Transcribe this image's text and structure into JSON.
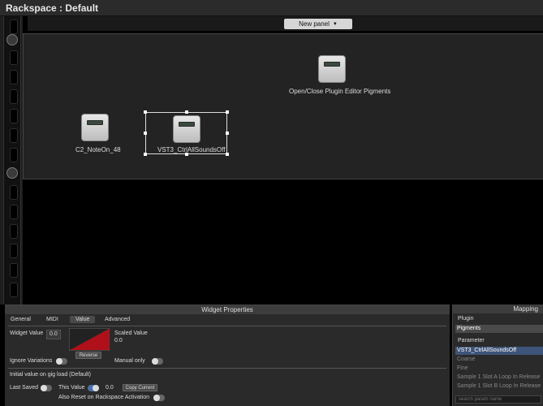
{
  "window": {
    "title": "Rackspace : Default"
  },
  "toolbar": {
    "new_panel_label": "New panel",
    "new_panel_arrow": "▼"
  },
  "panel": {
    "widgets": [
      {
        "label": "Open/Close Plugin Editor Pigments"
      },
      {
        "label": "C2_NoteOn_48"
      },
      {
        "label": "VST3_CtrlAllSoundsOff"
      }
    ]
  },
  "properties": {
    "header": "Widget Properties",
    "tabs": [
      "General",
      "MIDI",
      "Value",
      "Advanced"
    ],
    "active_tab": "Value",
    "widget_value_label": "Widget Value",
    "widget_value": "0.0",
    "reverse_label": "Reverse",
    "scaled_value_label": "Scaled Value",
    "scaled_value": "0.0",
    "ignore_variations_label": "Ignore Variations",
    "manual_only_label": "Manual only",
    "initial_value_label": "Initial value on gig load (Default)",
    "last_saved_label": "Last Saved",
    "this_value_label": "This Value",
    "this_value": "0.0",
    "copy_current_label": "Copy Current",
    "also_reset_label": "Also Reset on Rackspace Activation",
    "ignore_variations_on": false,
    "manual_only_on": false,
    "last_saved_on": false,
    "this_value_on": true,
    "also_reset_on": false
  },
  "mapping": {
    "header": "Mapping",
    "plugin_label": "Plugin",
    "plugin_value": "Pigments",
    "parameter_label": "Parameter",
    "parameters": [
      "VST3_CtrlAllSoundsOff",
      "Coarse",
      "Fine",
      "Sample 1 Slot A Loop In Release",
      "Sample 1 Slot B Loop In Release"
    ],
    "search_placeholder": "search param name"
  },
  "colors": {
    "accent": "#4a6ea8",
    "curve_fill": "#b0101a"
  }
}
